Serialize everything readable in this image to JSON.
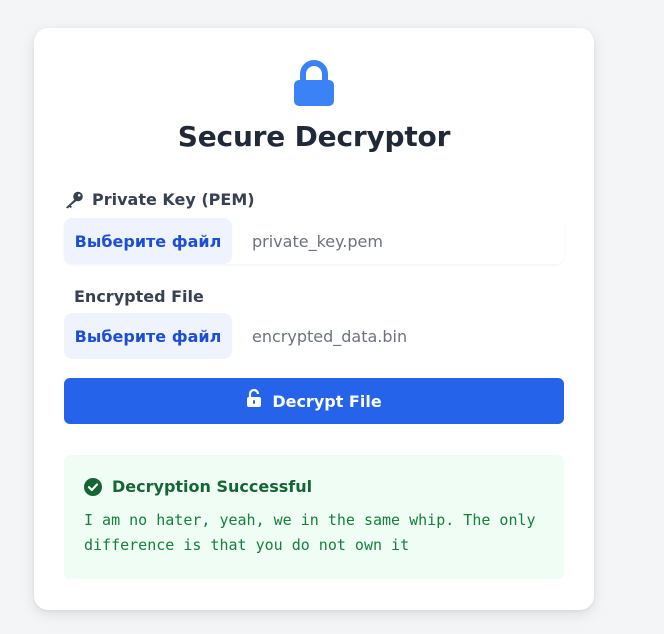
{
  "app": {
    "title": "Secure Decryptor",
    "lock_icon": "lock-icon",
    "accent_color": "#3b82f6"
  },
  "private_key": {
    "label": "Private Key (PEM)",
    "icon": "key-icon",
    "button_label": "Выберите файл",
    "file_name": "private_key.pem"
  },
  "encrypted_file": {
    "label": "Encrypted File",
    "button_label": "Выберите файл",
    "file_name": "encrypted_data.bin"
  },
  "decrypt_button": {
    "label": "Decrypt File",
    "icon": "unlock-icon",
    "color": "#2563eb"
  },
  "result": {
    "title": "Decryption Successful",
    "icon": "check-circle-icon",
    "text": "I am no hater, yeah, we in the same whip. The only difference is that you do not own it",
    "background": "#f0fdf4",
    "text_color": "#15803d"
  }
}
